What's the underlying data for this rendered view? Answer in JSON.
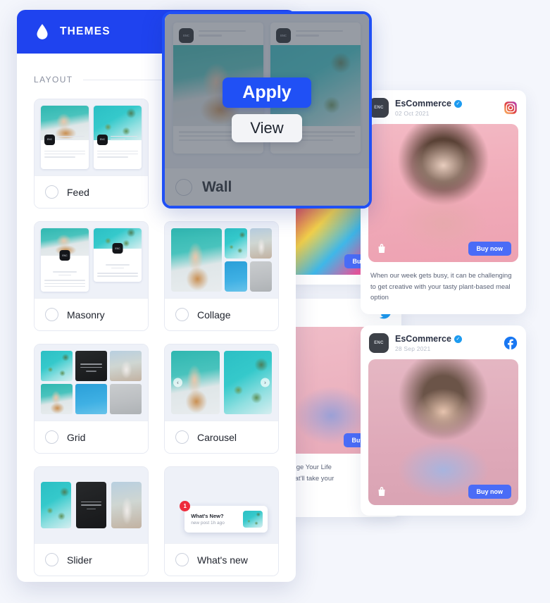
{
  "panel": {
    "title": "THEMES",
    "icon": "water-drop-icon",
    "section_label": "LAYOUT",
    "header_color": "#1f43ef"
  },
  "layouts": [
    {
      "id": "feed",
      "label": "Feed",
      "selected": false
    },
    {
      "id": "wall",
      "label": "Wall",
      "selected": false,
      "highlighted": true
    },
    {
      "id": "masonry",
      "label": "Masonry",
      "selected": false
    },
    {
      "id": "collage",
      "label": "Collage",
      "selected": false
    },
    {
      "id": "grid",
      "label": "Grid",
      "selected": false
    },
    {
      "id": "carousel",
      "label": "Carousel",
      "selected": false
    },
    {
      "id": "slider",
      "label": "Slider",
      "selected": false
    },
    {
      "id": "whatsnew",
      "label": "What's new",
      "selected": false
    }
  ],
  "overlay": {
    "apply_label": "Apply",
    "view_label": "View",
    "apply_color": "#2050f5",
    "view_color": "#f3f4f7",
    "border_color": "#2050f5"
  },
  "whatsnew_preview": {
    "title": "What's New?",
    "subtitle": "new post 1h ago",
    "badge": "1",
    "badge_color": "#ee2b3c"
  },
  "social_cards": [
    {
      "id": "instagram-post",
      "network": "instagram",
      "avatar_text": "ENC",
      "name": "EsCommerce",
      "verified": true,
      "date": "02 Oct 2021",
      "buy_label": "Buy now",
      "caption": "When our week gets busy, it can be challenging to get creative with your tasty plant-based meal option"
    },
    {
      "id": "facebook-post",
      "network": "facebook",
      "avatar_text": "ENC",
      "name": "EsCommerce",
      "verified": true,
      "date": "28 Sep 2021",
      "buy_label": "Buy now",
      "caption": ""
    },
    {
      "id": "twitter-post",
      "network": "twitter",
      "buy_label": "Buy now",
      "caption_line1": "Change Your Life",
      "caption_line2": "as that'll take your"
    },
    {
      "id": "background-post",
      "buy_label": "Buy now"
    }
  ],
  "colors": {
    "accent_blue": "#1f43ef",
    "buy_blue": "#4a6cf7",
    "page_bg": "#f4f6fc",
    "verified_blue": "#1d9bf0"
  }
}
